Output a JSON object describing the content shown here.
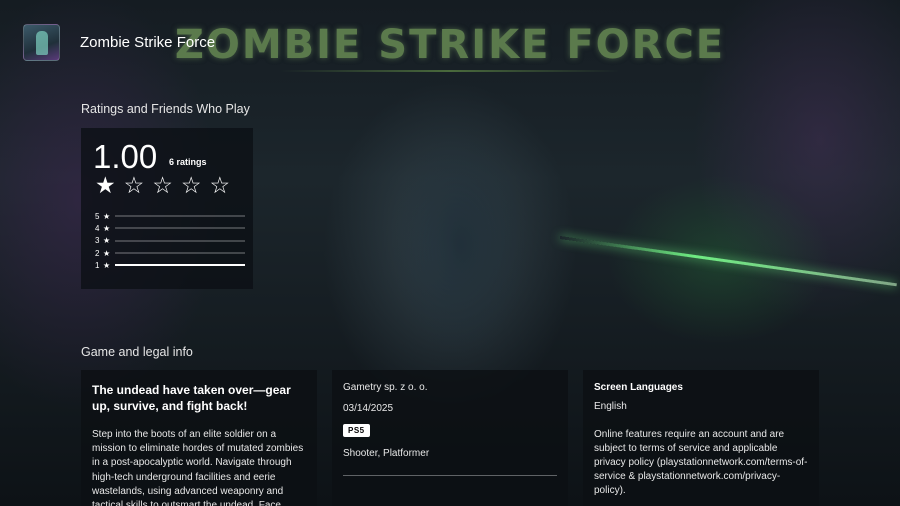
{
  "hero": {
    "banner_title": "ZOMBIE STRIKE FORCE"
  },
  "header": {
    "game_title": "Zombie Strike Force"
  },
  "ratings": {
    "section_title": "Ratings and Friends Who Play",
    "average": "1.00",
    "count_label": "6 ratings",
    "star_rating": 1,
    "star_max": 5,
    "distribution": [
      {
        "label": "5",
        "fraction": 0
      },
      {
        "label": "4",
        "fraction": 0
      },
      {
        "label": "3",
        "fraction": 0
      },
      {
        "label": "2",
        "fraction": 0
      },
      {
        "label": "1",
        "fraction": 1
      }
    ]
  },
  "info": {
    "section_title": "Game and legal info",
    "tagline": "The undead have taken over—gear up, survive, and fight back!",
    "description": "Step into the boots of an elite soldier on a mission to eliminate hordes of mutated zombies in a post-apocalyptic world. Navigate through high-tech underground facilities and eerie wastelands, using advanced weaponry and tactical skills to outsmart the undead. Face",
    "publisher": "Gametry sp. z o. o.",
    "release_date": "03/14/2025",
    "platform": "PS5",
    "genres": "Shooter, Platformer",
    "screen_languages_title": "Screen Languages",
    "screen_languages": "English",
    "online_notice": "Online features require an account and are subject to terms of service and applicable privacy policy (playstationnetwork.com/terms-of-service & playstationnetwork.com/privacy-policy)."
  }
}
